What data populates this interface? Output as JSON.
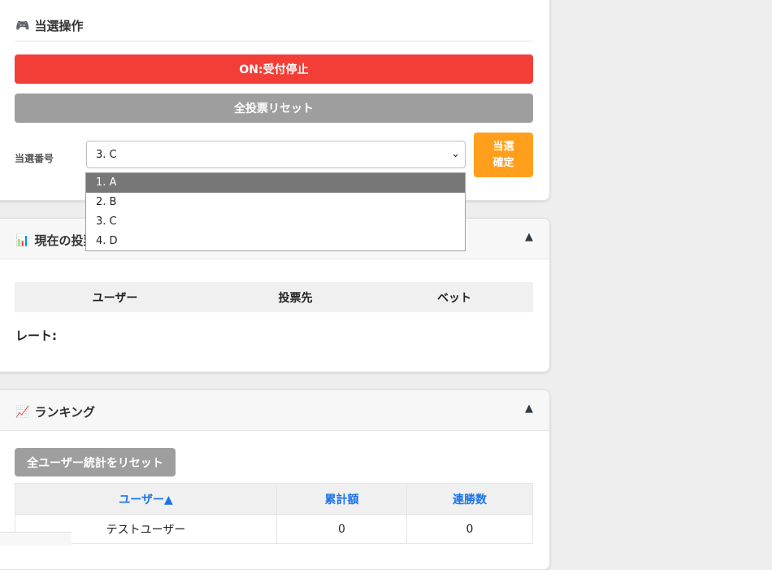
{
  "control": {
    "icon": "gamepad-icon",
    "title": "当選操作",
    "toggle_label": "ON:受付停止",
    "reset_votes_label": "全投票リセット",
    "winner_label": "当選番号",
    "winner_selected": "3. C",
    "confirm_line1": "当選",
    "confirm_line2": "確定",
    "options": [
      "1. A",
      "2. B",
      "3. C",
      "4. D"
    ],
    "colors": {
      "toggle": "#f33e37",
      "reset": "#9e9e9e",
      "confirm": "#ff9f1c"
    }
  },
  "votes": {
    "icon": "bar-chart-icon",
    "title": "現在の投票",
    "columns": [
      "ユーザー",
      "投票先",
      "ベット"
    ],
    "rate_label": "レート:"
  },
  "ranking": {
    "icon": "trend-chart-icon",
    "title": "ランキング",
    "reset_stats_label": "全ユーザー統計をリセット",
    "columns": [
      "ユーザー▲",
      "累計額",
      "連勝数"
    ],
    "rows": [
      {
        "user": "テストユーザー",
        "total": "0",
        "streak": "0"
      }
    ],
    "colors": {
      "header_text": "#1a73e8"
    }
  }
}
